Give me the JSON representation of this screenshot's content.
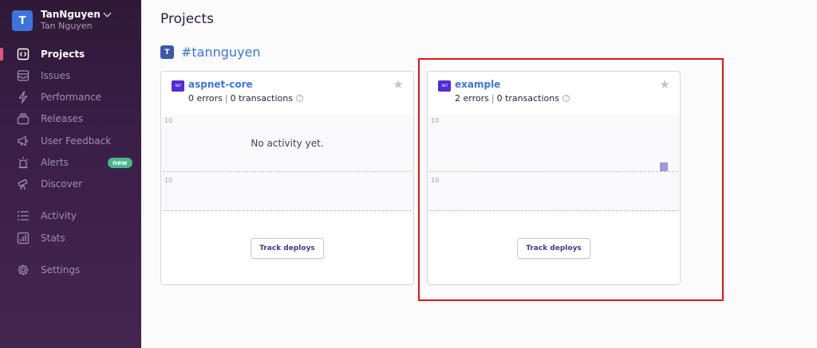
{
  "org": {
    "avatar_letter": "T",
    "name": "TanNguyen",
    "user": "Tan Nguyen"
  },
  "nav": {
    "items": [
      {
        "label": "Projects",
        "icon": "code-brackets-icon",
        "active": true
      },
      {
        "label": "Issues",
        "icon": "inbox-icon"
      },
      {
        "label": "Performance",
        "icon": "lightning-icon"
      },
      {
        "label": "Releases",
        "icon": "stack-icon"
      },
      {
        "label": "User Feedback",
        "icon": "megaphone-icon"
      },
      {
        "label": "Alerts",
        "icon": "siren-icon",
        "badge": "new"
      },
      {
        "label": "Discover",
        "icon": "telescope-icon"
      },
      {
        "label": "Activity",
        "icon": "list-icon"
      },
      {
        "label": "Stats",
        "icon": "bar-chart-icon"
      },
      {
        "label": "Settings",
        "icon": "gear-icon"
      }
    ]
  },
  "main": {
    "title": "Projects",
    "team": {
      "avatar_letter": "T",
      "name": "#tannguyen"
    },
    "projects": [
      {
        "platform_label": ".NET",
        "name": "aspnet-core",
        "errors": "0 errors",
        "transactions": "0 transactions",
        "tick_top": "10",
        "tick_bottom": "10",
        "empty_message": "No activity yet.",
        "track_label": "Track deploys"
      },
      {
        "platform_label": ".NET",
        "name": "example",
        "errors": "2 errors",
        "transactions": "0 transactions",
        "tick_top": "10",
        "tick_bottom": "10",
        "track_label": "Track deploys"
      }
    ]
  },
  "colors": {
    "accent": "#3d74db",
    "sidebar": "#3b1f49",
    "highlight": "#e8141c",
    "badge": "#44b889"
  }
}
